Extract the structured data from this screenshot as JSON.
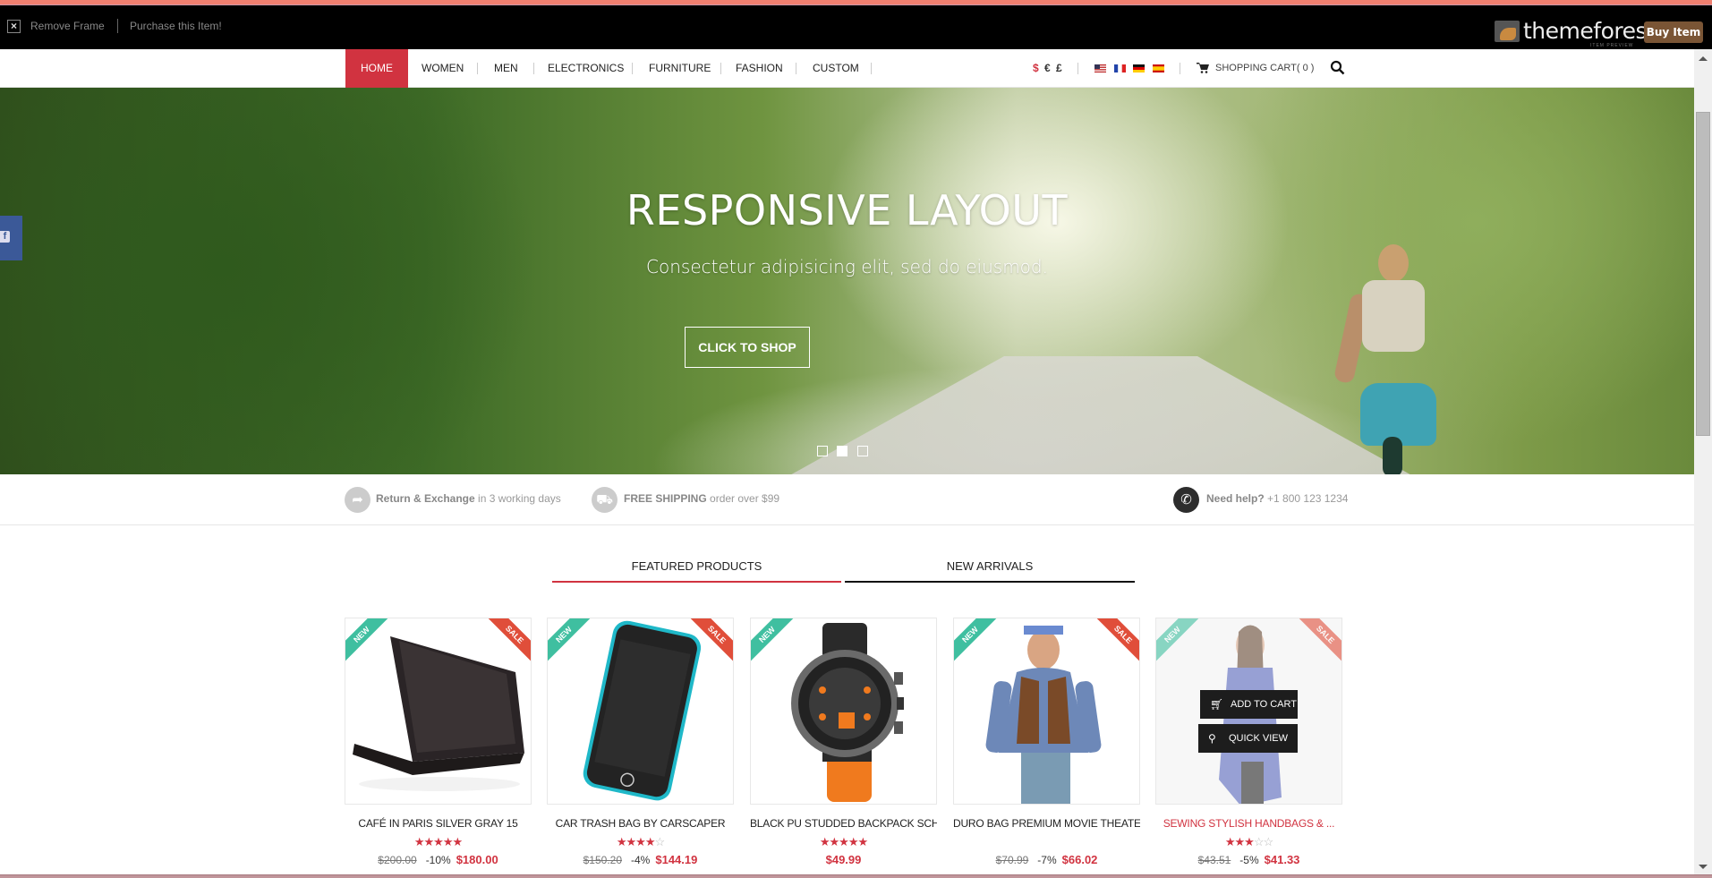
{
  "frame_bar": {
    "close_icon": "close-x-icon",
    "remove_frame": "Remove Frame",
    "purchase": "Purchase this Item!",
    "logo_text": "themeforest",
    "logo_sub": "ITEM PREVIEW",
    "buy_button": "Buy Item"
  },
  "nav": {
    "items": [
      {
        "label": "HOME",
        "active": true
      },
      {
        "label": "WOMEN"
      },
      {
        "label": "MEN"
      },
      {
        "label": "ELECTRONICS"
      },
      {
        "label": "FURNITURE"
      },
      {
        "label": "FASHION"
      },
      {
        "label": "CUSTOM"
      }
    ],
    "currencies": [
      "$",
      "€",
      "£"
    ],
    "active_currency": "$",
    "languages": [
      "English",
      "French",
      "German",
      "Spanish"
    ],
    "cart_label": "SHOPPING CART( 0 )",
    "cart_count": 0,
    "accent_color": "#d13340"
  },
  "hero": {
    "title": "RESPONSIVE LAYOUT",
    "subtitle": "Consectetur adipisicing elit, sed do eiusmod.",
    "button": "CLICK TO SHOP",
    "slides": 3,
    "active_slide": 2
  },
  "social": {
    "facebook": "f"
  },
  "features": [
    {
      "icon": "share-arrow-icon",
      "bold": "Return & Exchange",
      "text": " in 3 working days"
    },
    {
      "icon": "truck-icon",
      "bold": "FREE SHIPPING",
      "text": " order over $99"
    },
    {
      "icon": "phone-icon",
      "bold": "Need help?",
      "text": " +1 800 123 1234"
    }
  ],
  "tabs": [
    {
      "label": "FEATURED PRODUCTS",
      "active": true
    },
    {
      "label": "NEW ARRIVALS",
      "active": false
    }
  ],
  "products": [
    {
      "title": "CAFÉ IN PARIS SILVER GRAY 15",
      "rating": 5,
      "old_price": "$200.00",
      "discount": "-10%",
      "price": "$180.00",
      "new": true,
      "sale": true,
      "ribbon_new": "NEW",
      "ribbon_sale": "SALE"
    },
    {
      "title": "CAR TRASH BAG BY CARSCAPER",
      "rating": 4,
      "old_price": "$150.20",
      "discount": "-4%",
      "price": "$144.19",
      "new": true,
      "sale": true,
      "ribbon_new": "NEW",
      "ribbon_sale": "SALE"
    },
    {
      "title": "BLACK PU STUDDED BACKPACK SCHO",
      "rating": 5,
      "old_price": "",
      "discount": "",
      "price": "$49.99",
      "new": true,
      "sale": false,
      "ribbon_new": "NEW",
      "ribbon_sale": ""
    },
    {
      "title": "DURO BAG PREMIUM MOVIE THEATER",
      "rating": 0,
      "old_price": "$70.99",
      "discount": "-7%",
      "price": "$66.02",
      "new": true,
      "sale": true,
      "ribbon_new": "NEW",
      "ribbon_sale": "SALE"
    },
    {
      "title": "SEWING STYLISH HANDBAGS & ...",
      "rating": 3,
      "old_price": "$43.51",
      "discount": "-5%",
      "price": "$41.33",
      "new": true,
      "sale": true,
      "ribbon_new": "NEW",
      "ribbon_sale": "SALE",
      "hovered": true
    }
  ],
  "hover_actions": {
    "add_to_cart": "ADD TO CART",
    "quick_view": "QUICK VIEW"
  }
}
